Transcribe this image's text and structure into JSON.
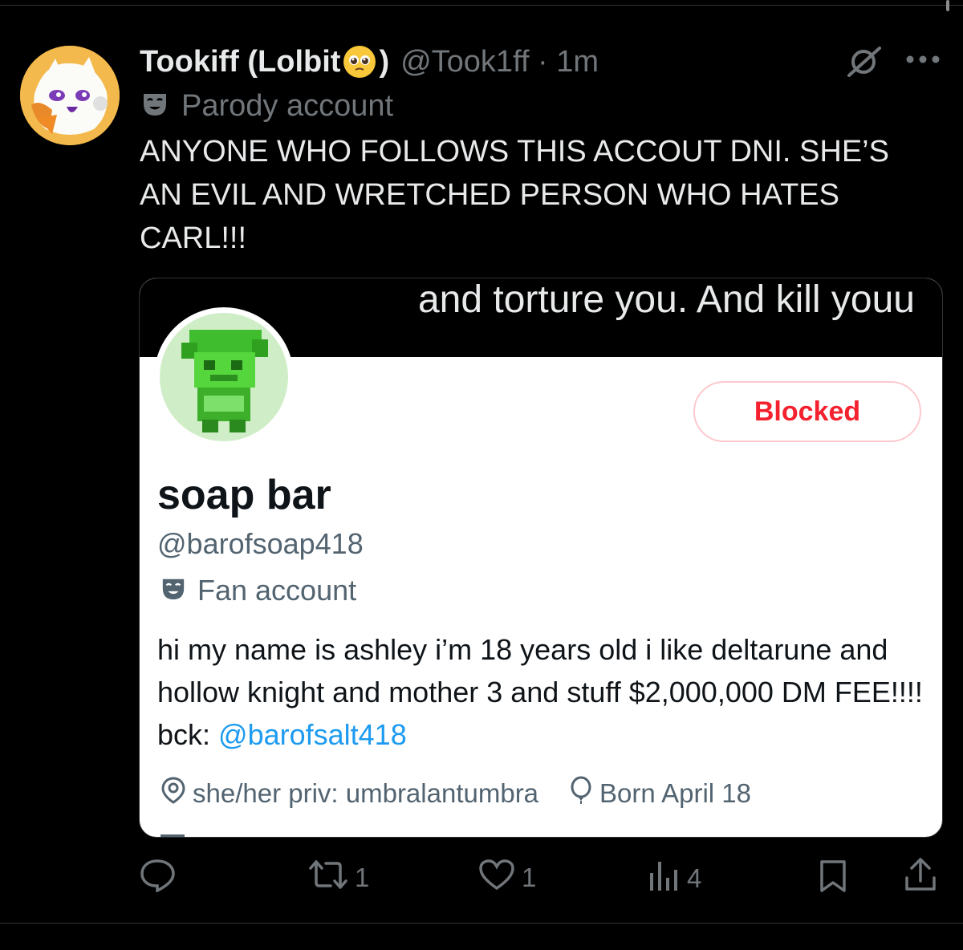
{
  "tweet": {
    "display_name_prefix": "Tookiff (Lolbit ",
    "display_name_suffix": ")",
    "handle_time": "@Took1ff · 1m",
    "label": "Parody account",
    "text": "ANYONE WHO FOLLOWS THIS ACCOUT DNI. SHE’S AN EVIL AND WRETCHED PERSON WHO HATES CARL!!!"
  },
  "screenshot": {
    "overlay_text": "and torture you. And kill youu",
    "blocked_label": "Blocked",
    "display_name": "soap bar",
    "handle": "@barofsoap418",
    "label": "Fan account",
    "bio_text": "hi my name is ashley i’m 18 years old i like deltarune and hollow knight and mother 3 and stuff $2,000,000 DM FEE!!!! bck: ",
    "bio_link": "@barofsalt418",
    "location": "she/her priv: umbralantumbra",
    "birthday": "Born April 18"
  },
  "actions": {
    "reply_count": "",
    "repost_count": "1",
    "like_count": "1",
    "views_count": "4"
  },
  "colors": {
    "background": "#000000",
    "primary_text": "#e7e9ea",
    "secondary_text": "#71767b",
    "link": "#1d9bf0",
    "blocked_red": "#f4212e"
  },
  "icons": [
    "grok-icon",
    "more-icon",
    "mask-icon",
    "location-icon",
    "balloon-icon",
    "calendar-icon",
    "reply-icon",
    "repost-icon",
    "like-icon",
    "views-icon",
    "bookmark-icon",
    "share-icon"
  ]
}
